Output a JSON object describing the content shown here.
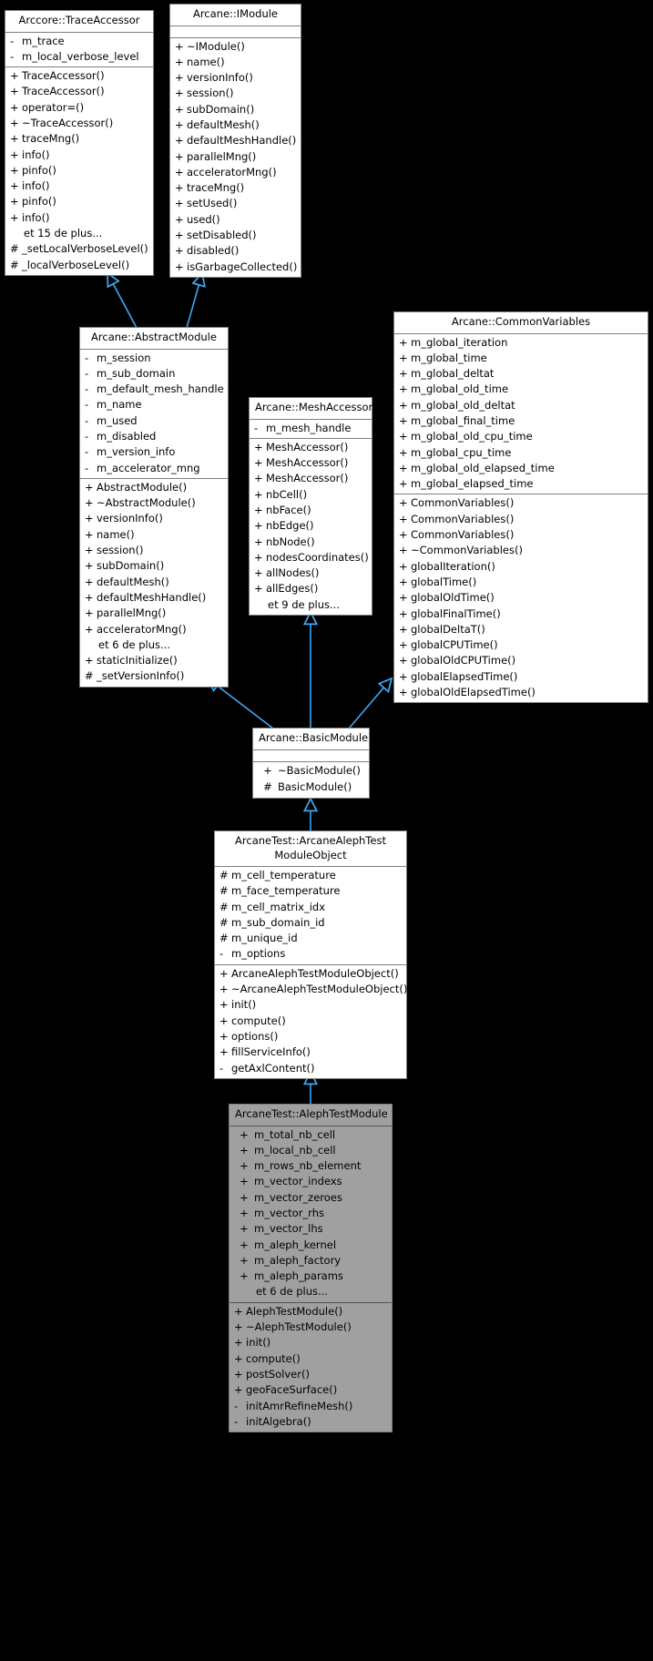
{
  "diagram": {
    "type": "uml-class-inheritance",
    "background": "#000000",
    "edge_color": "#3da8f5",
    "box_fill": "#ffffff",
    "focus_fill": "#a0a0a0",
    "border_color": "#7f7f7f",
    "more_label_prefix": "et"
  },
  "classes": {
    "trace_accessor": {
      "name": "Arccore::TraceAccessor",
      "attributes": [
        {
          "vis": "-",
          "name": "m_trace"
        },
        {
          "vis": "-",
          "name": "m_local_verbose_level"
        }
      ],
      "operations": [
        {
          "vis": "+",
          "name": "TraceAccessor()"
        },
        {
          "vis": "+",
          "name": "TraceAccessor()"
        },
        {
          "vis": "+",
          "name": "operator=()"
        },
        {
          "vis": "+",
          "name": "~TraceAccessor()"
        },
        {
          "vis": "+",
          "name": "traceMng()"
        },
        {
          "vis": "+",
          "name": "info()"
        },
        {
          "vis": "+",
          "name": "pinfo()"
        },
        {
          "vis": "+",
          "name": "info()"
        },
        {
          "vis": "+",
          "name": "pinfo()"
        },
        {
          "vis": "+",
          "name": "info()"
        },
        {
          "vis": "",
          "name": "et 15 de plus..."
        },
        {
          "vis": "#",
          "name": "_setLocalVerboseLevel()"
        },
        {
          "vis": "#",
          "name": "_localVerboseLevel()"
        }
      ]
    },
    "imodule": {
      "name": "Arcane::IModule",
      "attributes": [],
      "operations": [
        {
          "vis": "+",
          "name": "~IModule()"
        },
        {
          "vis": "+",
          "name": "name()"
        },
        {
          "vis": "+",
          "name": "versionInfo()"
        },
        {
          "vis": "+",
          "name": "session()"
        },
        {
          "vis": "+",
          "name": "subDomain()"
        },
        {
          "vis": "+",
          "name": "defaultMesh()"
        },
        {
          "vis": "+",
          "name": "defaultMeshHandle()"
        },
        {
          "vis": "+",
          "name": "parallelMng()"
        },
        {
          "vis": "+",
          "name": "acceleratorMng()"
        },
        {
          "vis": "+",
          "name": "traceMng()"
        },
        {
          "vis": "+",
          "name": "setUsed()"
        },
        {
          "vis": "+",
          "name": "used()"
        },
        {
          "vis": "+",
          "name": "setDisabled()"
        },
        {
          "vis": "+",
          "name": "disabled()"
        },
        {
          "vis": "+",
          "name": "isGarbageCollected()"
        }
      ]
    },
    "abstract_module": {
      "name": "Arcane::AbstractModule",
      "attributes": [
        {
          "vis": "-",
          "name": "m_session"
        },
        {
          "vis": "-",
          "name": "m_sub_domain"
        },
        {
          "vis": "-",
          "name": "m_default_mesh_handle"
        },
        {
          "vis": "-",
          "name": "m_name"
        },
        {
          "vis": "-",
          "name": "m_used"
        },
        {
          "vis": "-",
          "name": "m_disabled"
        },
        {
          "vis": "-",
          "name": "m_version_info"
        },
        {
          "vis": "-",
          "name": "m_accelerator_mng"
        }
      ],
      "operations": [
        {
          "vis": "+",
          "name": "AbstractModule()"
        },
        {
          "vis": "+",
          "name": "~AbstractModule()"
        },
        {
          "vis": "+",
          "name": "versionInfo()"
        },
        {
          "vis": "+",
          "name": "name()"
        },
        {
          "vis": "+",
          "name": "session()"
        },
        {
          "vis": "+",
          "name": "subDomain()"
        },
        {
          "vis": "+",
          "name": "defaultMesh()"
        },
        {
          "vis": "+",
          "name": "defaultMeshHandle()"
        },
        {
          "vis": "+",
          "name": "parallelMng()"
        },
        {
          "vis": "+",
          "name": "acceleratorMng()"
        },
        {
          "vis": "",
          "name": "et 6 de plus..."
        },
        {
          "vis": "+",
          "name": "staticInitialize()"
        },
        {
          "vis": "#",
          "name": "_setVersionInfo()"
        }
      ]
    },
    "mesh_accessor": {
      "name": "Arcane::MeshAccessor",
      "attributes": [
        {
          "vis": "-",
          "name": "m_mesh_handle"
        }
      ],
      "operations": [
        {
          "vis": "+",
          "name": "MeshAccessor()"
        },
        {
          "vis": "+",
          "name": "MeshAccessor()"
        },
        {
          "vis": "+",
          "name": "MeshAccessor()"
        },
        {
          "vis": "+",
          "name": "nbCell()"
        },
        {
          "vis": "+",
          "name": "nbFace()"
        },
        {
          "vis": "+",
          "name": "nbEdge()"
        },
        {
          "vis": "+",
          "name": "nbNode()"
        },
        {
          "vis": "+",
          "name": "nodesCoordinates()"
        },
        {
          "vis": "+",
          "name": "allNodes()"
        },
        {
          "vis": "+",
          "name": "allEdges()"
        },
        {
          "vis": "",
          "name": "et 9 de plus..."
        }
      ]
    },
    "common_variables": {
      "name": "Arcane::CommonVariables",
      "attributes": [
        {
          "vis": "+",
          "name": "m_global_iteration"
        },
        {
          "vis": "+",
          "name": "m_global_time"
        },
        {
          "vis": "+",
          "name": "m_global_deltat"
        },
        {
          "vis": "+",
          "name": "m_global_old_time"
        },
        {
          "vis": "+",
          "name": "m_global_old_deltat"
        },
        {
          "vis": "+",
          "name": "m_global_final_time"
        },
        {
          "vis": "+",
          "name": "m_global_old_cpu_time"
        },
        {
          "vis": "+",
          "name": "m_global_cpu_time"
        },
        {
          "vis": "+",
          "name": "m_global_old_elapsed_time"
        },
        {
          "vis": "+",
          "name": "m_global_elapsed_time"
        }
      ],
      "operations": [
        {
          "vis": "+",
          "name": "CommonVariables()"
        },
        {
          "vis": "+",
          "name": "CommonVariables()"
        },
        {
          "vis": "+",
          "name": "CommonVariables()"
        },
        {
          "vis": "+",
          "name": "~CommonVariables()"
        },
        {
          "vis": "+",
          "name": "globalIteration()"
        },
        {
          "vis": "+",
          "name": "globalTime()"
        },
        {
          "vis": "+",
          "name": "globalOldTime()"
        },
        {
          "vis": "+",
          "name": "globalFinalTime()"
        },
        {
          "vis": "+",
          "name": "globalDeltaT()"
        },
        {
          "vis": "+",
          "name": "globalCPUTime()"
        },
        {
          "vis": "+",
          "name": "globalOldCPUTime()"
        },
        {
          "vis": "+",
          "name": "globalElapsedTime()"
        },
        {
          "vis": "+",
          "name": "globalOldElapsedTime()"
        }
      ]
    },
    "basic_module": {
      "name": "Arcane::BasicModule",
      "attributes": [],
      "operations": [
        {
          "vis": "+",
          "name": "~BasicModule()"
        },
        {
          "vis": "#",
          "name": "BasicModule()"
        }
      ]
    },
    "module_object": {
      "name_line1": "ArcaneTest::ArcaneAlephTest",
      "name_line2": "ModuleObject",
      "attributes": [
        {
          "vis": "#",
          "name": "m_cell_temperature"
        },
        {
          "vis": "#",
          "name": "m_face_temperature"
        },
        {
          "vis": "#",
          "name": "m_cell_matrix_idx"
        },
        {
          "vis": "#",
          "name": "m_sub_domain_id"
        },
        {
          "vis": "#",
          "name": "m_unique_id"
        },
        {
          "vis": "-",
          "name": "m_options"
        }
      ],
      "operations": [
        {
          "vis": "+",
          "name": "ArcaneAlephTestModuleObject()"
        },
        {
          "vis": "+",
          "name": "~ArcaneAlephTestModuleObject()"
        },
        {
          "vis": "+",
          "name": "init()"
        },
        {
          "vis": "+",
          "name": "compute()"
        },
        {
          "vis": "+",
          "name": "options()"
        },
        {
          "vis": "+",
          "name": "fillServiceInfo()"
        },
        {
          "vis": "-",
          "name": "getAxlContent()"
        }
      ]
    },
    "aleph_test_module": {
      "name": "ArcaneTest::AlephTestModule",
      "focus": true,
      "attributes": [
        {
          "vis": "+",
          "name": "m_total_nb_cell"
        },
        {
          "vis": "+",
          "name": "m_local_nb_cell"
        },
        {
          "vis": "+",
          "name": "m_rows_nb_element"
        },
        {
          "vis": "+",
          "name": "m_vector_indexs"
        },
        {
          "vis": "+",
          "name": "m_vector_zeroes"
        },
        {
          "vis": "+",
          "name": "m_vector_rhs"
        },
        {
          "vis": "+",
          "name": "m_vector_lhs"
        },
        {
          "vis": "+",
          "name": "m_aleph_kernel"
        },
        {
          "vis": "+",
          "name": "m_aleph_factory"
        },
        {
          "vis": "+",
          "name": "m_aleph_params"
        },
        {
          "vis": "",
          "name": "et 6 de plus..."
        }
      ],
      "operations": [
        {
          "vis": "+",
          "name": "AlephTestModule()"
        },
        {
          "vis": "+",
          "name": "~AlephTestModule()"
        },
        {
          "vis": "+",
          "name": "init()"
        },
        {
          "vis": "+",
          "name": "compute()"
        },
        {
          "vis": "+",
          "name": "postSolver()"
        },
        {
          "vis": "+",
          "name": "geoFaceSurface()"
        },
        {
          "vis": "-",
          "name": "initAmrRefineMesh()"
        },
        {
          "vis": "-",
          "name": "initAlgebra()"
        }
      ]
    }
  }
}
